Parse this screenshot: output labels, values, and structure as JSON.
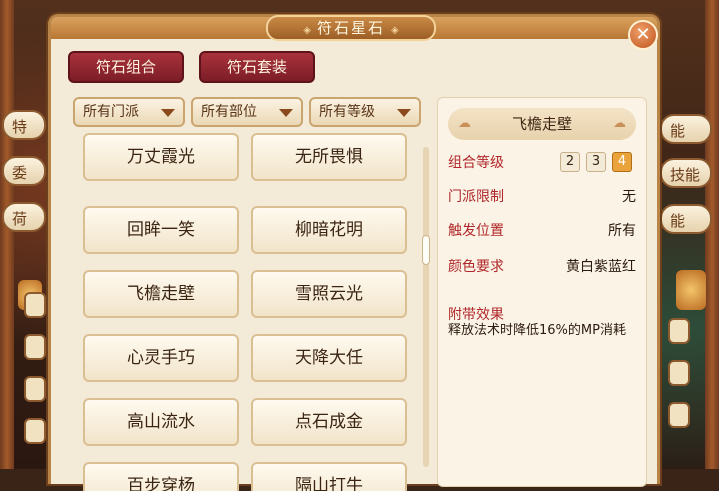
{
  "dialog": {
    "title": "符石星石",
    "close_label": "✕"
  },
  "tabs": [
    {
      "label": "符石组合"
    },
    {
      "label": "符石套装"
    }
  ],
  "filters": [
    {
      "label": "所有门派"
    },
    {
      "label": "所有部位"
    },
    {
      "label": "所有等级"
    }
  ],
  "combos": [
    "万丈霞光",
    "无所畏惧",
    "回眸一笑",
    "柳暗花明",
    "飞檐走壁",
    "雪照云光",
    "心灵手巧",
    "天降大任",
    "高山流水",
    "点石成金",
    "百步穿杨",
    "隔山打牛"
  ],
  "detail": {
    "title": "飞檐走壁",
    "level_label": "组合等级",
    "levels": [
      "2",
      "3",
      "4"
    ],
    "selected_level": "4",
    "school_label": "门派限制",
    "school_value": "无",
    "trigger_label": "触发位置",
    "trigger_value": "所有",
    "color_label": "颜色要求",
    "color_value": "黄白紫蓝红",
    "effect_label": "附带效果",
    "effect_value": "释放法术时降低16%的MP消耗"
  },
  "background": {
    "left_tabs": [
      "特",
      "委",
      "荷"
    ],
    "right_tabs": [
      "能",
      "技能",
      "能"
    ]
  },
  "colors": {
    "tab_red": "#8b2430",
    "label_red": "#b0262a",
    "active_level": "#e9a33a"
  }
}
